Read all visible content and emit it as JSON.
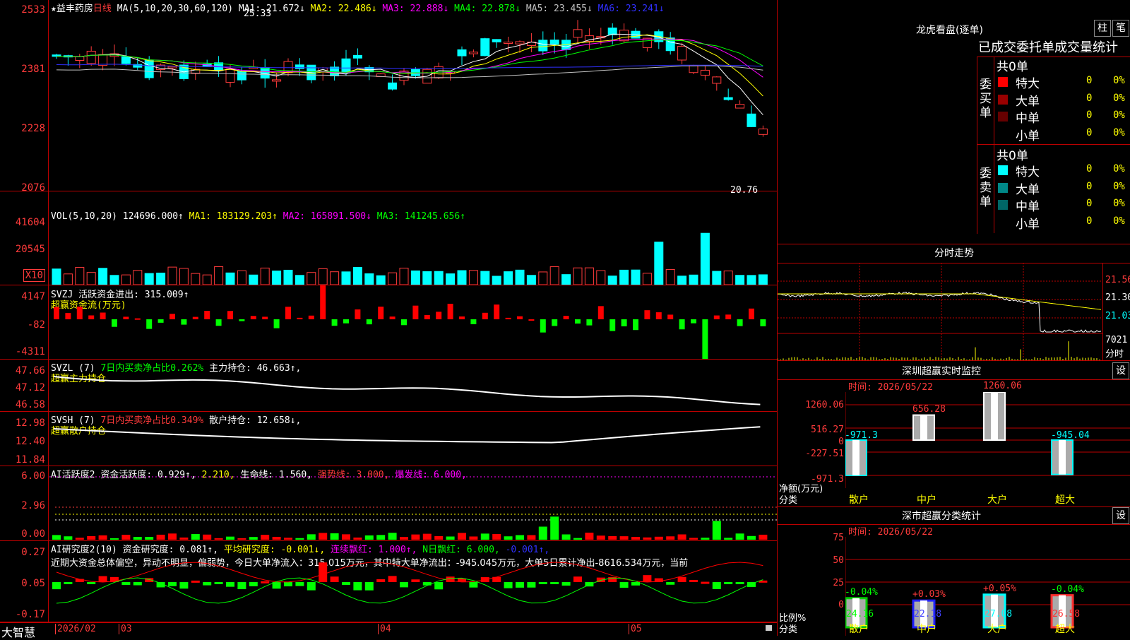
{
  "stock": {
    "star": "★",
    "name": "益丰药房",
    "period": "日线"
  },
  "kline": {
    "ma_header": "MA(5,10,20,30,60,120)",
    "ma": [
      {
        "label": "MA1: 21.672↓",
        "color": "#ffffff"
      },
      {
        "label": "MA2: 22.486↓",
        "color": "#ffff00"
      },
      {
        "label": "MA3: 22.888↓",
        "color": "#ff00ff"
      },
      {
        "label": "MA4: 22.878↓",
        "color": "#00ff00"
      },
      {
        "label": "MA5: 23.455↓",
        "color": "#c0c0c0"
      },
      {
        "label": "MA6: 23.241↓",
        "color": "#3030ff"
      }
    ],
    "axis": [
      "2533",
      "2381",
      "2228",
      "2076"
    ],
    "high_label": "25.33",
    "low_label": "20.76"
  },
  "vol": {
    "header": "VOL(5,10,20)",
    "value": "124696.000↑",
    "ma1": "MA1: 183129.203↑",
    "ma2": "MA2: 165891.500↓",
    "ma3": "MA3: 141245.656↑",
    "axis": [
      "41604",
      "20545"
    ],
    "unit": "X10"
  },
  "svzj": {
    "header": "SVZJ",
    "active": "活跃资金进出: 315.009↑",
    "sub": "超赢资金流(万元)",
    "axis": [
      "4147",
      "-82",
      "-4311"
    ]
  },
  "svzl": {
    "header": "SVZL (7)",
    "ratio": "7日内买卖净占比0.262%",
    "hold": "主力持仓: 46.663↑,",
    "sub": "超赢主力持仓",
    "axis": [
      "47.66",
      "47.12",
      "46.58"
    ]
  },
  "svsh": {
    "header": "SVSH (7)",
    "ratio": "7日内买卖净占比0.349%",
    "hold": "散户持仓: 12.658↓,",
    "sub": "超赢散户持仓",
    "axis": [
      "12.98",
      "12.40",
      "11.84"
    ]
  },
  "ai1": {
    "header": "AI活跃度2",
    "a": "资金活跃度: 0.929↑,",
    "b": "2.210,",
    "c": "生命线: 1.560,",
    "d": "强势线: 3.000,",
    "e": "爆发线: 6.000,",
    "axis": [
      "6.00",
      "2.96",
      "0.00"
    ]
  },
  "ai2": {
    "header": "AI研究度2(10)",
    "a": "资金研究度: 0.081↑,",
    "b": "平均研究度: -0.001↓,",
    "c": "连续飘红: 1.000↑,",
    "d": "N日飘红: 6.000,",
    "e": "-0.001↑,",
    "comment": "近期大资金总体偏空，异动不明显，偏弱势，今日大单净流入：315.015万元，其中特大单净流出：-945.045万元，大单5日累计净出-8616.534万元，当前",
    "axis": [
      "0.27",
      "0.05",
      "-0.17"
    ]
  },
  "footer": {
    "brand": "大智慧",
    "date": "2026/02",
    "m3": "03",
    "m4": "04",
    "m5": "05"
  },
  "dragon": {
    "title": "龙虎看盘(逐单)",
    "btn1": "柱",
    "btn2": "笔",
    "subtitle": "已成交委托单成交量统计",
    "buy_total": "共0单",
    "buy_side": "委买单",
    "sell_total": "共0单",
    "sell_side": "委卖单",
    "buy_rows": [
      {
        "label": "特大",
        "num": "0",
        "pct": "0%",
        "color": "#ff0000"
      },
      {
        "label": "大单",
        "num": "0",
        "pct": "0%",
        "color": "#990000"
      },
      {
        "label": "中单",
        "num": "0",
        "pct": "0%",
        "color": "#660000"
      },
      {
        "label": "小单",
        "num": "0",
        "pct": "0%",
        "color": "#000000"
      }
    ],
    "sell_rows": [
      {
        "label": "特大",
        "num": "0",
        "pct": "0%",
        "color": "#00ffff"
      },
      {
        "label": "大单",
        "num": "0",
        "pct": "0%",
        "color": "#008888"
      },
      {
        "label": "中单",
        "num": "0",
        "pct": "0%",
        "color": "#006666"
      },
      {
        "label": "小单",
        "num": "0",
        "pct": "0%",
        "color": "#000000"
      }
    ]
  },
  "intraday": {
    "title": "分时走势",
    "axis": [
      "21.56",
      "21.30",
      "21.03"
    ],
    "vol": "7021",
    "vol_unit": "分时"
  },
  "monitor": {
    "title": "深圳超赢实时监控",
    "btn": "设",
    "time": "时间: 2026/05/22",
    "axis": [
      "1260.06",
      "516.27",
      "0",
      "-227.51",
      "-971.3"
    ],
    "ylabel": "净额(万元)",
    "xlabel": "分类",
    "cats": [
      "散户",
      "中户",
      "大户",
      "超大"
    ],
    "values": [
      "-971.3",
      "656.28",
      "1260.06",
      "-945.04"
    ]
  },
  "classify": {
    "title": "深市超赢分类统计",
    "btn": "设",
    "time": "时间: 2026/05/22",
    "axis": [
      "75",
      "50",
      "25",
      "0"
    ],
    "ylabel": "比例%",
    "xlabel": "分类",
    "cats": [
      "散户",
      "中户",
      "大户",
      "超大"
    ],
    "pcts": [
      "24.16",
      "22.18",
      "27.08",
      "26.58"
    ],
    "changes": [
      "-0.04%",
      "+0.03%",
      "+0.05%",
      "-0.04%"
    ]
  }
}
